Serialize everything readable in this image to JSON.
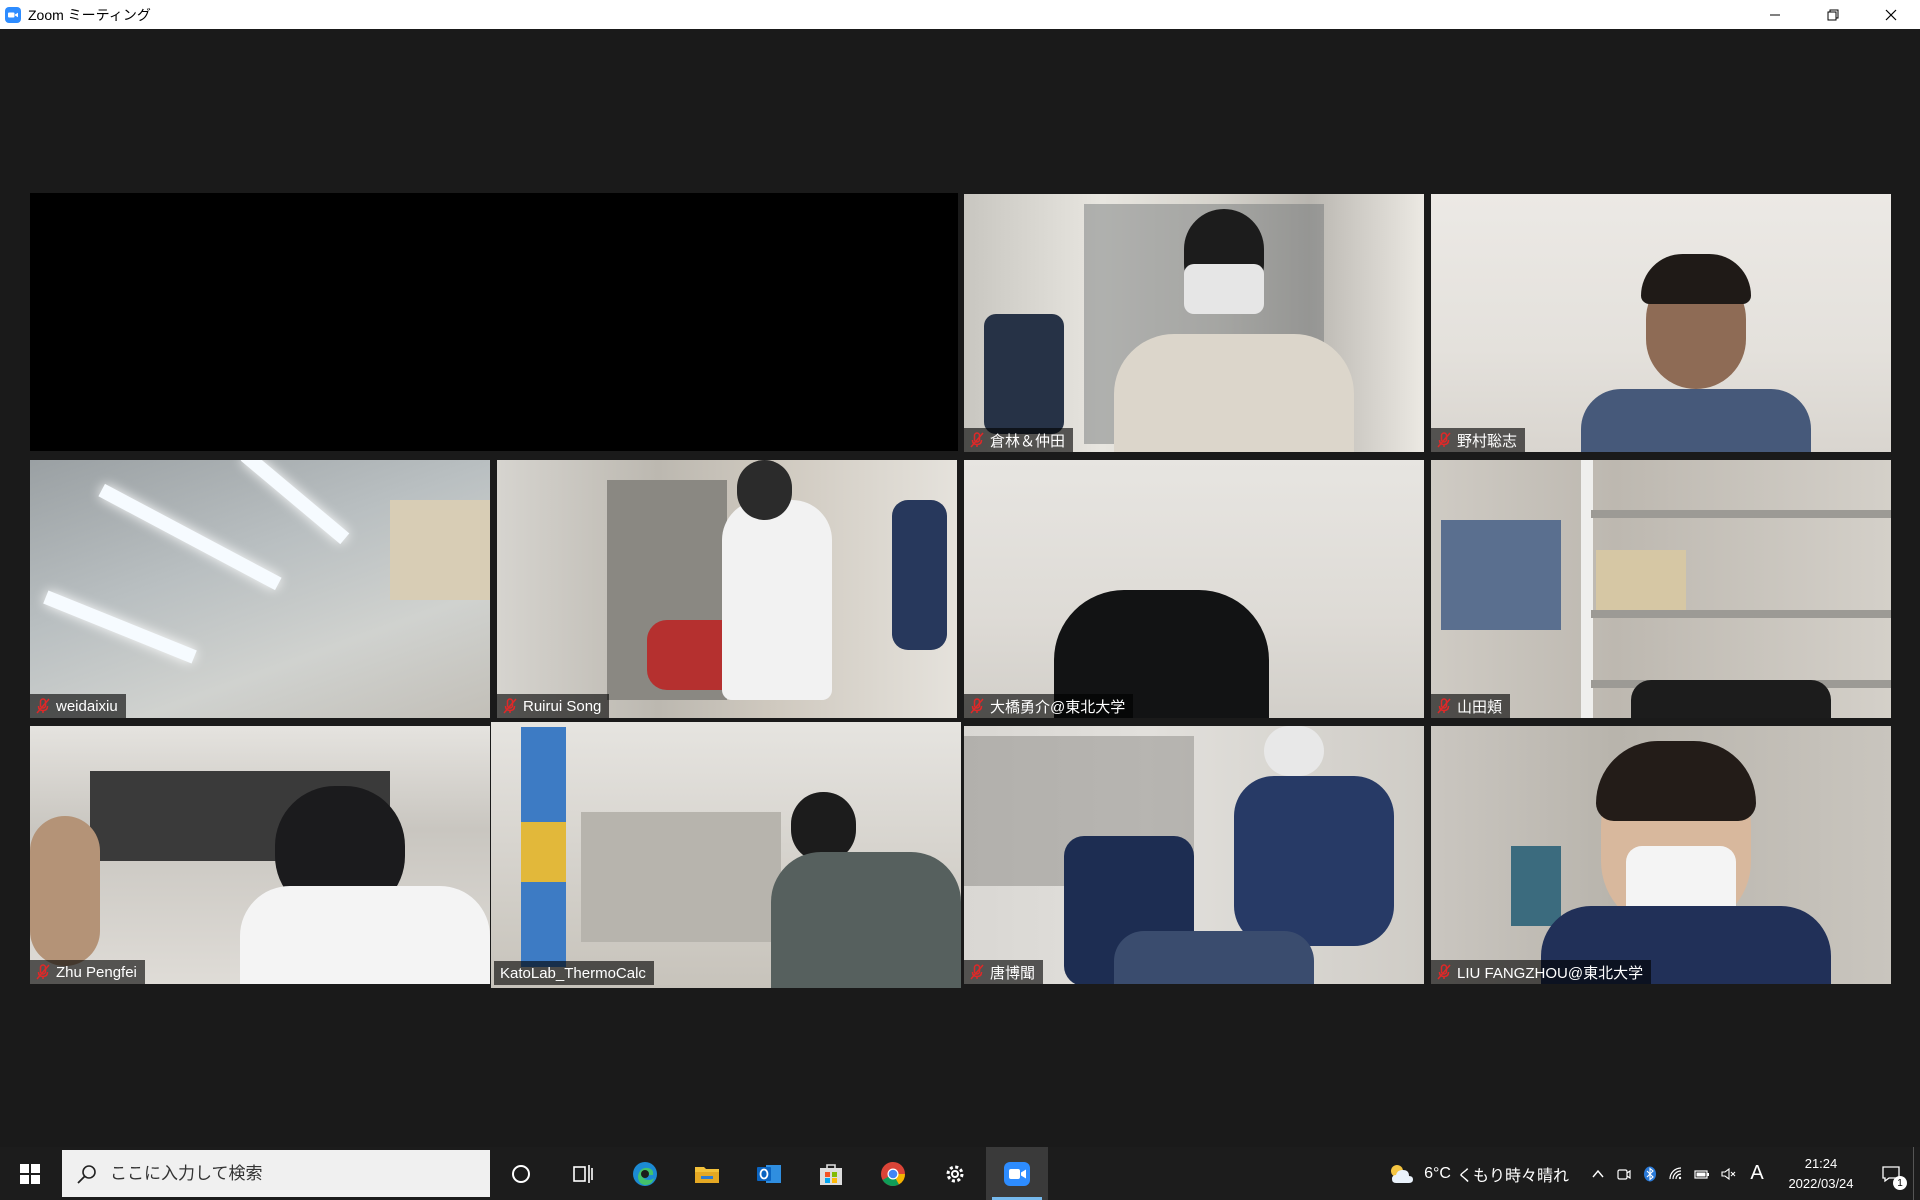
{
  "window": {
    "title": "Zoom ミーティング"
  },
  "participants": [
    {
      "name": "",
      "muted": false,
      "video": "off",
      "active": false
    },
    {
      "name": "倉林＆仲田",
      "muted": true,
      "active": false
    },
    {
      "name": "野村聡志",
      "muted": true,
      "active": false
    },
    {
      "name": "weidaixiu",
      "muted": true,
      "active": false
    },
    {
      "name": "Ruirui Song",
      "muted": true,
      "active": false
    },
    {
      "name": "大橋勇介@東北大学",
      "muted": true,
      "active": false
    },
    {
      "name": "山田頬",
      "muted": true,
      "active": false
    },
    {
      "name": "Zhu Pengfei",
      "muted": true,
      "active": false
    },
    {
      "name": "KatoLab_ThermoCalc",
      "muted": false,
      "active": true
    },
    {
      "name": "唐博聞",
      "muted": true,
      "active": false
    },
    {
      "name": "LIU FANGZHOU@東北大学",
      "muted": true,
      "active": false
    }
  ],
  "taskbar": {
    "search_placeholder": "ここに入力して検索",
    "apps": [
      "cortana-icon",
      "task-view-icon",
      "edge-icon",
      "file-explorer-icon",
      "outlook-icon",
      "store-icon",
      "chrome-icon",
      "settings-icon",
      "zoom-icon"
    ],
    "active_app": "zoom-icon"
  },
  "tray": {
    "temperature": "6°C",
    "weather": "くもり時々晴れ",
    "ime": "A",
    "time": "21:24",
    "date": "2022/03/24",
    "notification_count": "1"
  },
  "colors": {
    "active_speaker_border": "#d8e36a",
    "mute_red": "#e02828",
    "zoom_blue": "#2d8cff"
  }
}
